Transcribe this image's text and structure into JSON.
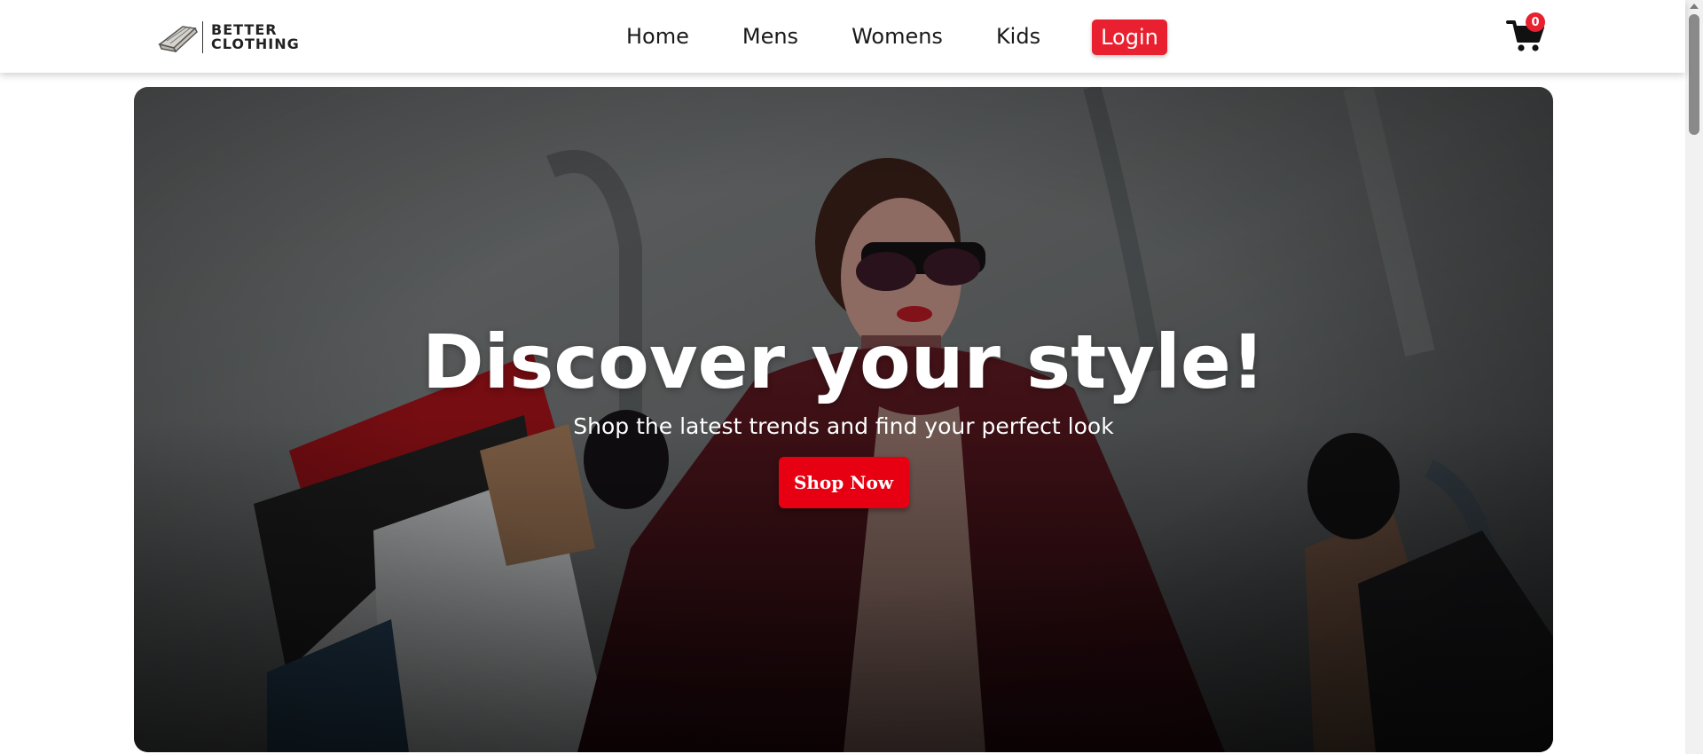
{
  "header": {
    "logo": {
      "line1": "BETTER",
      "line2": "CLOTHING"
    },
    "nav": [
      {
        "label": "Home"
      },
      {
        "label": "Mens"
      },
      {
        "label": "Womens"
      },
      {
        "label": "Kids"
      }
    ],
    "login_label": "Login",
    "cart": {
      "icon": "cart-icon",
      "count": "0"
    }
  },
  "hero": {
    "title": "Discover your style!",
    "subtitle": "Shop the latest trends and find your perfect look",
    "cta_label": "Shop Now",
    "image": "woman-with-shopping-bags"
  },
  "colors": {
    "accent": "#e8202f",
    "cta": "#e60012",
    "header_bg": "#ffffff",
    "text": "#1a1a1a"
  }
}
